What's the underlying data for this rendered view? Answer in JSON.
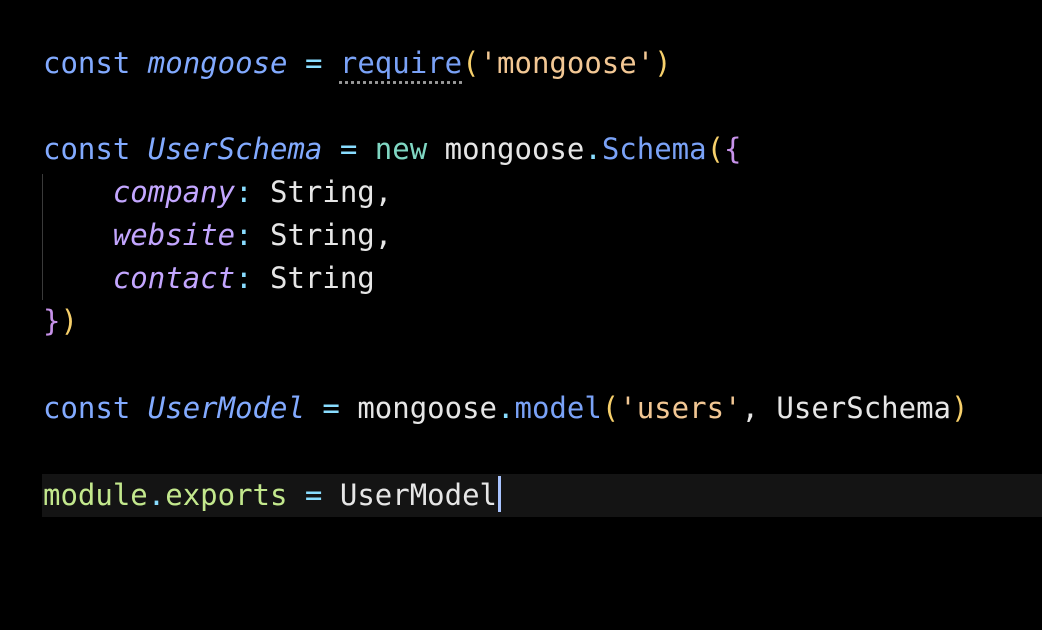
{
  "colors": {
    "background": "#000000",
    "keyword": "#82aaff",
    "string": "#f2c794",
    "property": "#c3a6ff",
    "paren": "#f7d06b",
    "brace": "#c792ea",
    "module": "#c3e88d",
    "plain": "#e6e6e6"
  },
  "code": {
    "line1": {
      "kw": "const",
      "name": "mongoose",
      "op": "=",
      "call": "require",
      "open": "(",
      "arg": "'mongoose'",
      "close": ")"
    },
    "line3": {
      "kw": "const",
      "name": "UserSchema",
      "op": "=",
      "new": "new",
      "obj": "mongoose",
      "dot": ".",
      "method": "Schema",
      "open_paren": "(",
      "open_brace": "{"
    },
    "line4": {
      "key": "company",
      "colon": ":",
      "type": "String",
      "comma": ","
    },
    "line5": {
      "key": "website",
      "colon": ":",
      "type": "String",
      "comma": ","
    },
    "line6": {
      "key": "contact",
      "colon": ":",
      "type": "String"
    },
    "line7": {
      "close_brace": "}",
      "close_paren": ")"
    },
    "line9": {
      "kw": "const",
      "name": "UserModel",
      "op": "=",
      "obj": "mongoose",
      "dot": ".",
      "method": "model",
      "open": "(",
      "arg1": "'users'",
      "comma": ",",
      "arg2": "UserSchema",
      "close": ")"
    },
    "line11": {
      "module": "module",
      "dot": ".",
      "exports": "exports",
      "op": "=",
      "value": "UserModel"
    }
  }
}
